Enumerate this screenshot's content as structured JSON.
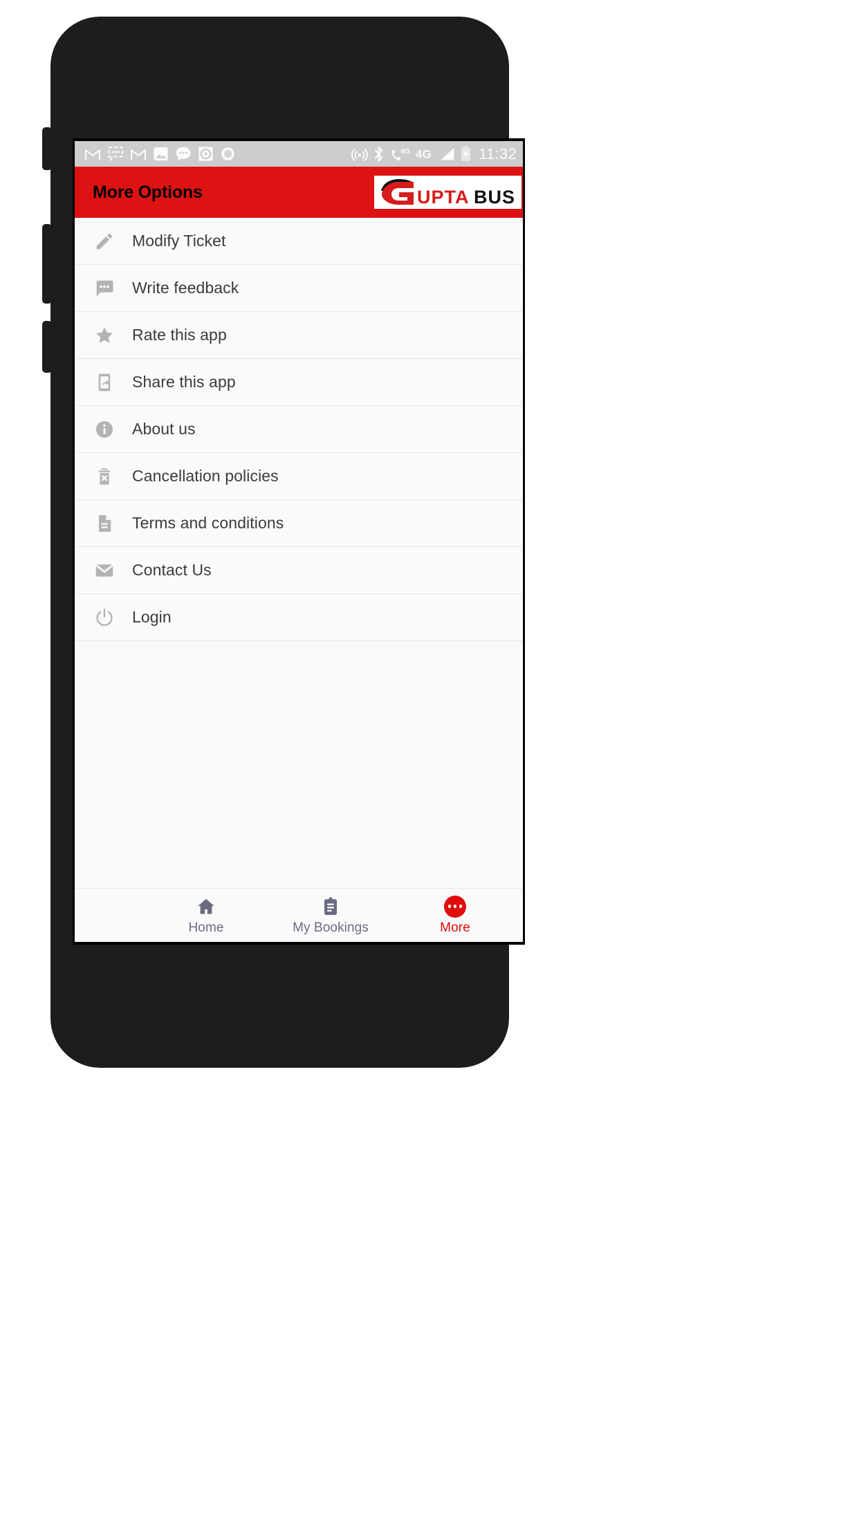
{
  "device": {
    "frame_color": "#1d1d1d",
    "screen_bezel_color": "#000000"
  },
  "status_bar": {
    "background": "#cdcdcd",
    "foreground": "#fbfbfb",
    "time": "11:32",
    "left_icons": [
      {
        "name": "gmail-icon",
        "label": "M"
      },
      {
        "name": "chat-bubble-dots-icon",
        "label": ""
      },
      {
        "name": "gmail-icon-2",
        "label": "M"
      },
      {
        "name": "photo-image-icon",
        "label": ""
      },
      {
        "name": "message-bubble-icon",
        "label": ""
      },
      {
        "name": "media-record-icon",
        "label": ""
      },
      {
        "name": "circle-icon",
        "label": ""
      }
    ],
    "right_icons": [
      {
        "name": "cast-nearby-share-icon",
        "label": ""
      },
      {
        "name": "bluetooth-icon",
        "label": ""
      },
      {
        "name": "volte-call-4g-icon",
        "label": "4G"
      },
      {
        "name": "mobile-data-4g-icon",
        "label": "4G"
      },
      {
        "name": "signal-strength-icon",
        "label": ""
      },
      {
        "name": "battery-charging-icon",
        "label": ""
      }
    ]
  },
  "app_bar": {
    "title": "More Options",
    "background": "#dd1212",
    "title_color": "#000000",
    "logo": {
      "name": "gupta-bus-logo",
      "word_primary": "GUPTA",
      "word_secondary": "BUS",
      "primary_color": "#d81b1b",
      "secondary_color": "#111111",
      "plate_color": "#ffffff"
    }
  },
  "menu": {
    "icon_color": "#b3b3b3",
    "text_color": "#3b3b3b",
    "divider_color": "#e6e6e6",
    "items": [
      {
        "icon": "pencil-edit-icon",
        "label": "Modify Ticket"
      },
      {
        "icon": "chat-feedback-icon",
        "label": "Write feedback"
      },
      {
        "icon": "star-icon",
        "label": "Rate this app"
      },
      {
        "icon": "share-phone-icon",
        "label": "Share this app"
      },
      {
        "icon": "info-circle-icon",
        "label": "About us"
      },
      {
        "icon": "trash-cancel-icon",
        "label": "Cancellation policies"
      },
      {
        "icon": "document-text-icon",
        "label": "Terms and conditions"
      },
      {
        "icon": "envelope-mail-icon",
        "label": "Contact Us"
      },
      {
        "icon": "power-login-icon",
        "label": "Login"
      }
    ]
  },
  "bottom_nav": {
    "inactive_color": "#6b6b80",
    "active_color": "#e00c0c",
    "tabs": [
      {
        "icon": "home-icon",
        "label": "Home",
        "active": false
      },
      {
        "icon": "clipboard-icon",
        "label": "My Bookings",
        "active": false
      },
      {
        "icon": "more-dots-icon",
        "label": "More",
        "active": true
      }
    ]
  }
}
